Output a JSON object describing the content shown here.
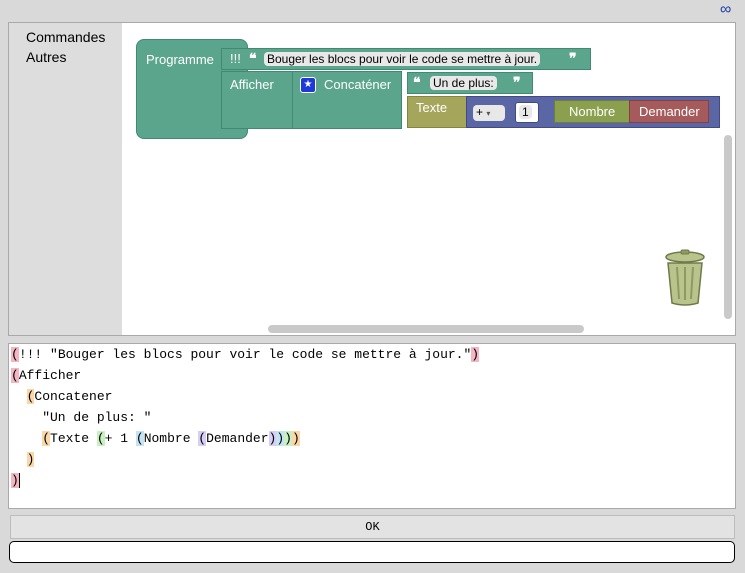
{
  "app": {
    "infinity": "∞"
  },
  "toolbox": {
    "items": [
      "Commandes",
      "Autres"
    ]
  },
  "blocks": {
    "programme": "Programme",
    "bang": "!!!",
    "comment_text": "Bouger les blocs pour voir le code se mettre à jour.",
    "open_quote": "❝",
    "close_quote": "❞",
    "afficher": "Afficher",
    "concatener": "Concaténer",
    "un_de_plus": "Un de plus:",
    "texte": "Texte",
    "plus_op": "+",
    "number": "1",
    "nombre": "Nombre",
    "demander": "Demander",
    "star": "★"
  },
  "code": {
    "l1_open": "(",
    "l1_text": "!!! \"Bouger les blocs pour voir le code se mettre à jour.\"",
    "l1_close": ")",
    "l2_open": "(",
    "l2_text": "Afficher",
    "l3_indent": "  ",
    "l3_open": "(",
    "l3_text": "Concatener",
    "l4_text": "    \"Un de plus: \"",
    "l5_indent": "    ",
    "l5_open1": "(",
    "l5_t1": "Texte ",
    "l5_open2": "(",
    "l5_t2": "+ 1 ",
    "l5_open3": "(",
    "l5_t3": "Nombre ",
    "l5_open4": "(",
    "l5_t4": "Demander",
    "l5_c4": ")",
    "l5_c3": ")",
    "l5_c2": ")",
    "l5_c1": ")",
    "l6_indent": "  ",
    "l6_close": ")",
    "l7_close": ")"
  },
  "ok_label": "OK",
  "answer_value": "",
  "colors": {
    "green": "#5ba58c",
    "olive": "#a5a55b",
    "indigo": "#5b67a5",
    "red": "#a55b5b"
  }
}
